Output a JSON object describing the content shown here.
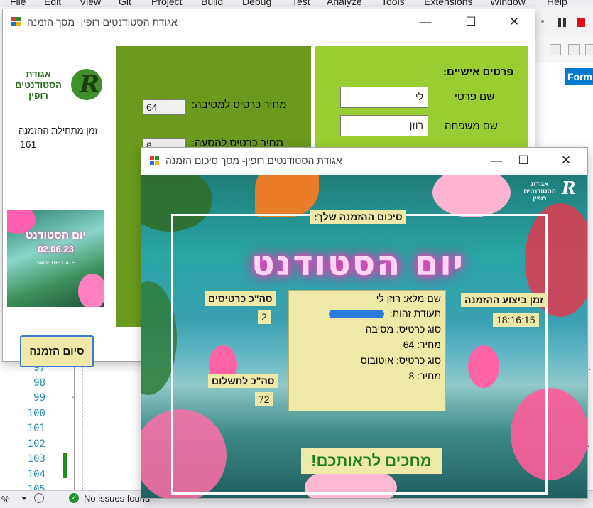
{
  "ide": {
    "menu": [
      "File",
      "Edit",
      "View",
      "Git",
      "Project",
      "Build",
      "Debug",
      "Test",
      "Analyze",
      "Tools",
      "Extensions",
      "Window",
      "Help"
    ],
    "form_tab": "Form",
    "line_numbers": [
      "97",
      "98",
      "99",
      "100",
      "101",
      "102",
      "103",
      "104",
      "105"
    ],
    "status": {
      "zoom": "%",
      "issues": "No issues found"
    }
  },
  "order_window": {
    "title": "אגודת הסטודנטים רופין- מסך הזמנה",
    "logo_text": "אגודת הסטודנטים רופין",
    "timer_label": "זמן מתחילת ההזמנה",
    "timer_value": "161",
    "poster_title": "יום הסטודנט",
    "poster_date": "02.06.23",
    "poster_sub": "SAVE THE DATE",
    "finish_button": "סיום הזמנה",
    "party_price_label": "מחיר כרטיס למסיבה:",
    "party_price_value": "64",
    "bus_price_label": "מחיר כרטיס להסעה:",
    "bus_price_value": "8",
    "personal_header": "פרטים אישיים:",
    "first_name_label": "שם פרטי",
    "first_name_value": "לי",
    "last_name_label": "שם משפחה",
    "last_name_value": "רוזן"
  },
  "summary_window": {
    "title": "אגודת הסטודנטים רופין- מסך סיכום הזמנה",
    "logo_text": "אגודת הסטודנטים רופין",
    "summary_header": "סיכום ההזמנה שלך:",
    "event_title": "יום הסטודנט",
    "tickets_label": "סה\"כ כרטיסים",
    "tickets_value": "2",
    "payment_label": "סה\"כ לתשלום",
    "payment_value": "72",
    "time_label": "זמן ביצוע ההזמנה",
    "time_value": "18:16:15",
    "summary_lines": [
      "שם מלא: רוזן לי",
      "תעודת זהות:",
      "סוג כרטיס: מסיבה",
      "מחיר: 64",
      "סוג כרטיס: אוטובוס",
      "מחיר: 8"
    ],
    "footer_banner": "מחכים לראותכם!"
  },
  "colors": {
    "dark_green": "#6b9a1f",
    "light_green": "#9acd32",
    "label_yellow": "#efe9a8",
    "ide_blue": "#007acc"
  }
}
